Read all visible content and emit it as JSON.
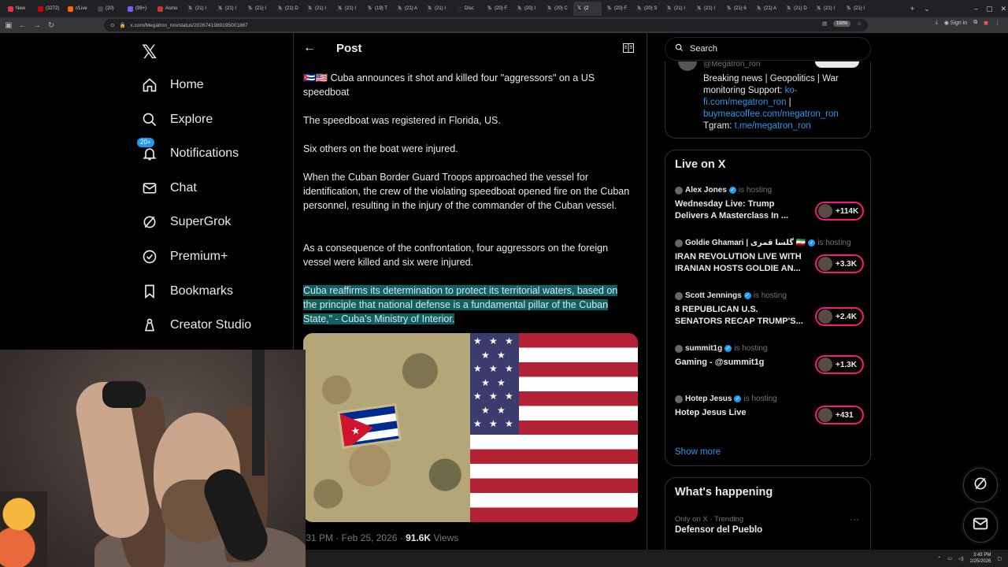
{
  "browser": {
    "tabs": [
      {
        "label": "New"
      },
      {
        "label": "(3272)"
      },
      {
        "label": "r/Live"
      },
      {
        "label": "(20)"
      },
      {
        "label": "(99+)"
      },
      {
        "label": "Asmo"
      },
      {
        "label": "(21) I"
      },
      {
        "label": "(21) I"
      },
      {
        "label": "(21) I"
      },
      {
        "label": "(21) D"
      },
      {
        "label": "(21) I"
      },
      {
        "label": "(21) I"
      },
      {
        "label": "(19) T"
      },
      {
        "label": "(21) A"
      },
      {
        "label": "(21) I"
      },
      {
        "label": "Disc"
      },
      {
        "label": "(20) F"
      },
      {
        "label": "(20) I"
      },
      {
        "label": "(20) C"
      },
      {
        "label": "(2"
      },
      {
        "label": "(20) F"
      },
      {
        "label": "(20) S"
      },
      {
        "label": "(21) I"
      },
      {
        "label": "(21) I"
      },
      {
        "label": "(21) 6"
      },
      {
        "label": "(21) A"
      },
      {
        "label": "(21) D"
      },
      {
        "label": "(21) I"
      },
      {
        "label": "(21) I"
      }
    ],
    "url": "x.com/Megatron_ron/status/2026741989195001867",
    "zoom": "150%",
    "signin_label": "Sign in"
  },
  "nav": {
    "items": [
      {
        "label": "Home",
        "icon": "home-icon"
      },
      {
        "label": "Explore",
        "icon": "search-icon"
      },
      {
        "label": "Notifications",
        "icon": "bell-icon",
        "badge": "20+"
      },
      {
        "label": "Chat",
        "icon": "mail-icon"
      },
      {
        "label": "SuperGrok",
        "icon": "grok-icon"
      },
      {
        "label": "Premium+",
        "icon": "verified-icon"
      },
      {
        "label": "Bookmarks",
        "icon": "bookmark-icon"
      },
      {
        "label": "Creator Studio",
        "icon": "creator-icon"
      }
    ]
  },
  "post": {
    "header_title": "Post",
    "paragraphs": [
      "🇨🇺🇺🇸 Cuba announces it shot and killed four \"aggressors\" on a US speedboat",
      "The speedboat was registered in Florida, US.",
      "Six others on the boat were injured.",
      "When the Cuban Border Guard Troops approached the vessel for identification, the crew of the violating speedboat opened fire on the Cuban personnel, resulting in the injury of the commander of the Cuban vessel.",
      "As a consequence of the confrontation, four aggressors on the foreign vessel were killed and six were injured."
    ],
    "highlighted": "Cuba reaffirms its determination to protect its territorial waters, based on the principle that national defense is a fundamental pillar of the Cuban State,\" - Cuba's Ministry of Interior.",
    "time": ":31 PM · Feb 25, 2026 · ",
    "views_count": "91.6K",
    "views_label": " Views"
  },
  "sidebar": {
    "search_placeholder": "Search",
    "bio": {
      "handle": "@Megatron_ron",
      "text1": "Breaking news | Geopolitics | War monitoring Support: ",
      "link1": "ko-fi.com/megatron_ron",
      "sep": " | ",
      "link2": "buymeacoffee.com/megatron_ron",
      "text2": " Tgram: ",
      "link3": "t.me/megatron_ron"
    },
    "live_title": "Live on X",
    "live": [
      {
        "host": "Alex Jones",
        "status": "is hosting",
        "title": "Wednesday Live: Trump Delivers A Masterclass In ...",
        "count": "+114K"
      },
      {
        "host": "Goldie Ghamari | گلسا قمری 🇮🇷",
        "status": "is hosting",
        "title": "IRAN REVOLUTION LIVE WITH IRANIAN HOSTS GOLDIE AN...",
        "count": "+3.3K"
      },
      {
        "host": "Scott Jennings",
        "status": "is hosting",
        "title": "8 REPUBLICAN U.S. SENATORS RECAP TRUMP'S...",
        "count": "+2.4K"
      },
      {
        "host": "summit1g",
        "status": "is hosting",
        "title": "Gaming - @summit1g",
        "count": "+1.3K"
      },
      {
        "host": "Hotep Jesus",
        "status": "is hosting",
        "title": "Hotep Jesus Live",
        "count": "+431"
      }
    ],
    "show_more": "Show more",
    "whats_happening": "What's happening",
    "trend_meta": "Only on X · Trending",
    "trend_name": "Defensor del Pueblo"
  },
  "taskbar": {
    "time": "3:43 PM",
    "date": "2/25/2026"
  },
  "colors": {
    "accent": "#1d9bf0",
    "live_ring": "#f91880",
    "highlight_bg": "#155f5f"
  }
}
